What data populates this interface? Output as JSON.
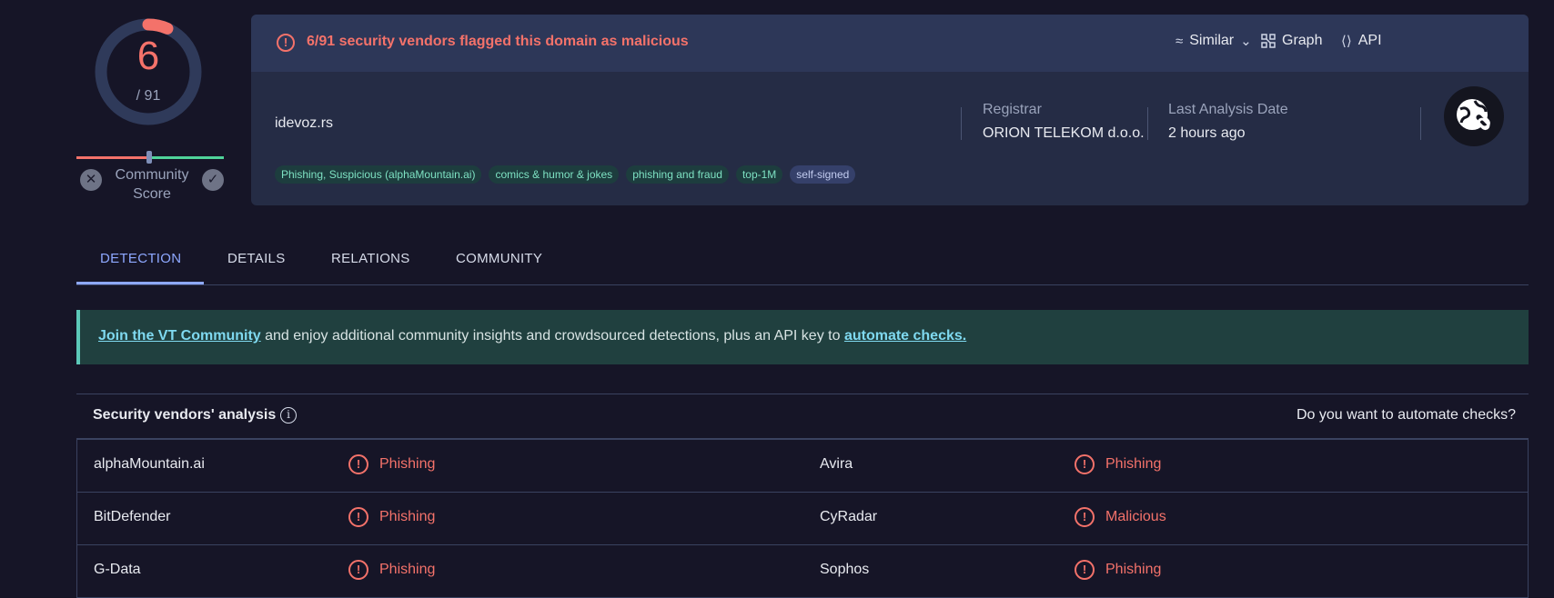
{
  "score": {
    "value": "6",
    "total": "/ 91",
    "ring_fraction": 0.066,
    "ring_color": "#f4726a"
  },
  "community": {
    "label_line1": "Community",
    "label_line2": "Score",
    "down_symbol": "✕",
    "up_symbol": "✓"
  },
  "alert": {
    "icon": "alert-circle-icon",
    "text": "6/91 security vendors flagged this domain as malicious"
  },
  "toolbar": {
    "similar": "Similar",
    "graph": "Graph",
    "api": "API"
  },
  "domain": "idevoz.rs",
  "tags": [
    "Phishing, Suspicious (alphaMountain.ai)",
    "comics & humor & jokes",
    "phishing and fraud",
    "top-1M",
    "self-signed"
  ],
  "registrar": {
    "label": "Registrar",
    "value": "ORION TELEKOM d.o.o."
  },
  "last_analysis": {
    "label": "Last Analysis Date",
    "value": "2 hours ago"
  },
  "tabs": [
    "DETECTION",
    "DETAILS",
    "RELATIONS",
    "COMMUNITY"
  ],
  "banner": {
    "link1": "Join the VT Community",
    "middle": " and enjoy additional community insights and crowdsourced detections, plus an API key to ",
    "link2": "automate checks."
  },
  "vendors": {
    "title": "Security vendors' analysis",
    "automate": "Do you want to automate checks?",
    "rows": [
      {
        "left_name": "alphaMountain.ai",
        "left_result": "Phishing",
        "right_name": "Avira",
        "right_result": "Phishing"
      },
      {
        "left_name": "BitDefender",
        "left_result": "Phishing",
        "right_name": "CyRadar",
        "right_result": "Malicious"
      },
      {
        "left_name": "G-Data",
        "left_result": "Phishing",
        "right_name": "Sophos",
        "right_result": "Phishing"
      }
    ]
  }
}
